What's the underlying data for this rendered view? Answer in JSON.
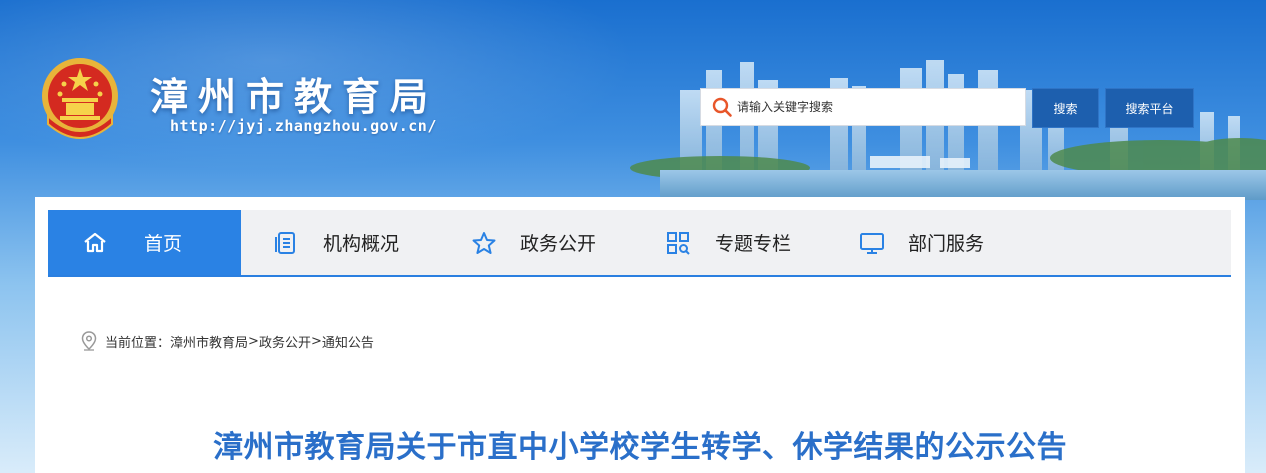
{
  "header": {
    "site_title": "漳州市教育局",
    "site_url": "http://jyj.zhangzhou.gov.cn/",
    "emblem_icon": "national-emblem-icon"
  },
  "search": {
    "placeholder": "请输入关键字搜索",
    "search_label": "搜索",
    "platform_label": "搜索平台"
  },
  "nav": {
    "items": [
      {
        "label": "首页",
        "icon": "home-icon",
        "active": true
      },
      {
        "label": "机构概况",
        "icon": "document-list-icon",
        "active": false
      },
      {
        "label": "政务公开",
        "icon": "star-icon",
        "active": false
      },
      {
        "label": "专题专栏",
        "icon": "grid-search-icon",
        "active": false
      },
      {
        "label": "部门服务",
        "icon": "monitor-icon",
        "active": false
      }
    ]
  },
  "breadcrumb": {
    "prefix": "当前位置：",
    "items": [
      "漳州市教育局",
      "政务公开",
      "通知公告"
    ],
    "separator": ">"
  },
  "article": {
    "title": "漳州市教育局关于市直中小学校学生转学、休学结果的公示公告"
  },
  "colors": {
    "nav_active": "#2a82e4",
    "button": "#1d5fae",
    "title": "#2a6fc9",
    "nav_bg": "#f0f1f3"
  }
}
